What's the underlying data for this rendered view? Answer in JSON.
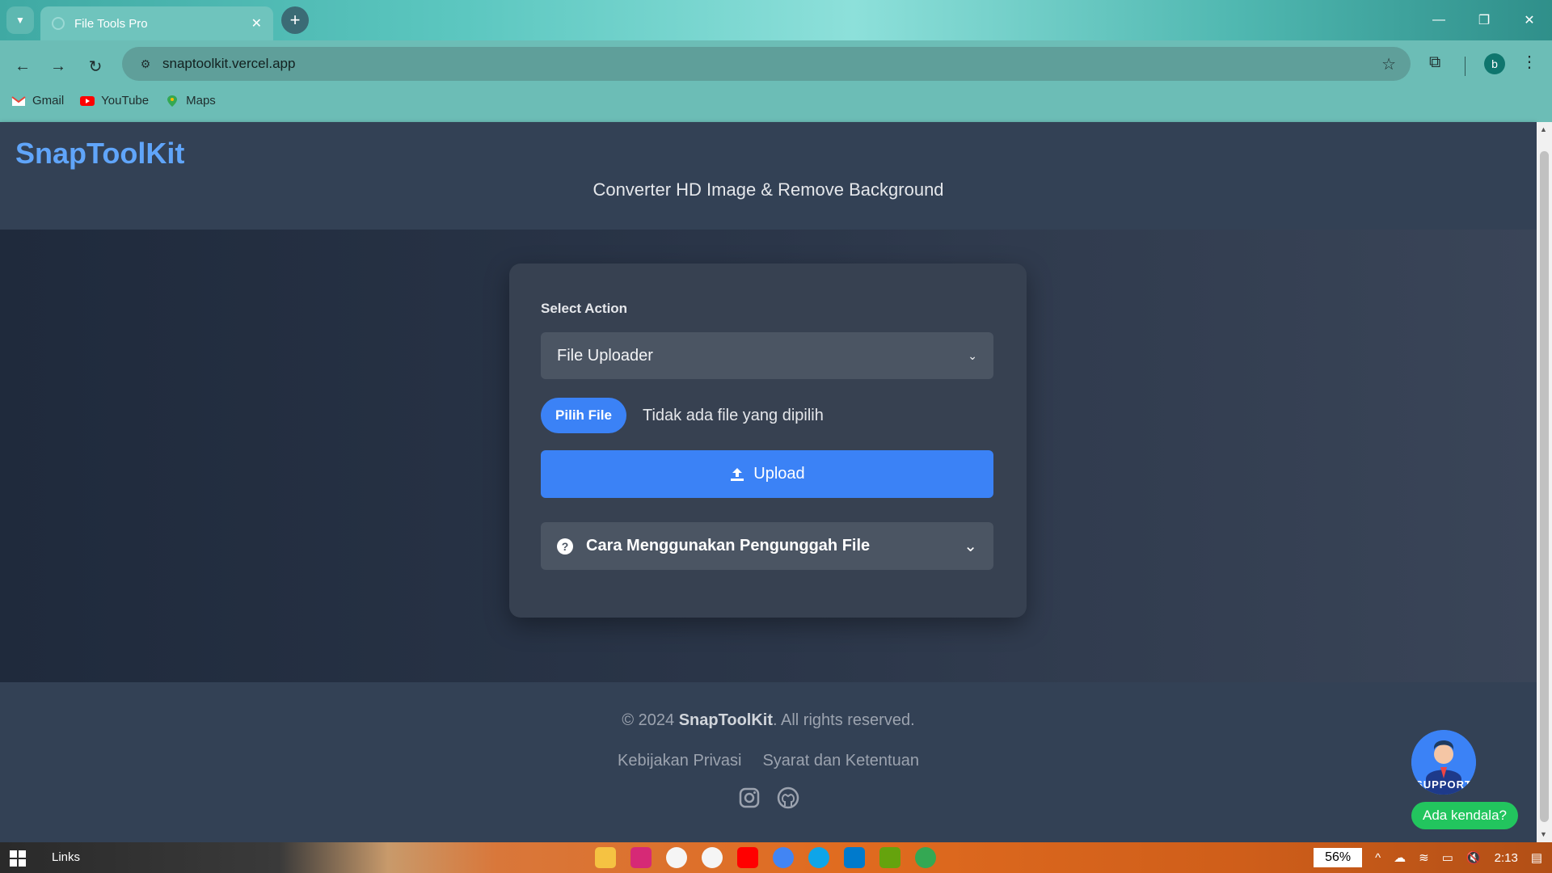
{
  "browser": {
    "tab_title": "File Tools Pro",
    "url": "snaptoolkit.vercel.app",
    "profile_initial": "b",
    "bookmarks": [
      {
        "label": "Gmail"
      },
      {
        "label": "YouTube"
      },
      {
        "label": "Maps"
      }
    ]
  },
  "header": {
    "logo": "SnapToolKit",
    "subtitle": "Converter HD Image & Remove Background"
  },
  "card": {
    "select_label": "Select Action",
    "select_value": "File Uploader",
    "pick_file_label": "Pilih File",
    "no_file_text": "Tidak ada file yang dipilih",
    "upload_label": "Upload",
    "howto_label": "Cara Menggunakan Pengunggah File"
  },
  "footer": {
    "copyright_prefix": "© 2024",
    "copyright_brand": "SnapToolKit",
    "copyright_suffix": ". All rights reserved.",
    "links": [
      {
        "label": "Kebijakan Privasi"
      },
      {
        "label": "Syarat dan Ketentuan"
      }
    ]
  },
  "support": {
    "avatar_text": "SUPPORT",
    "help_label": "Ada kendala?"
  },
  "taskbar": {
    "links_label": "Links",
    "battery": "56%",
    "time": "2:13"
  },
  "colors": {
    "accent": "#3b82f6",
    "logo": "#60a5fa",
    "help": "#22c55e"
  }
}
